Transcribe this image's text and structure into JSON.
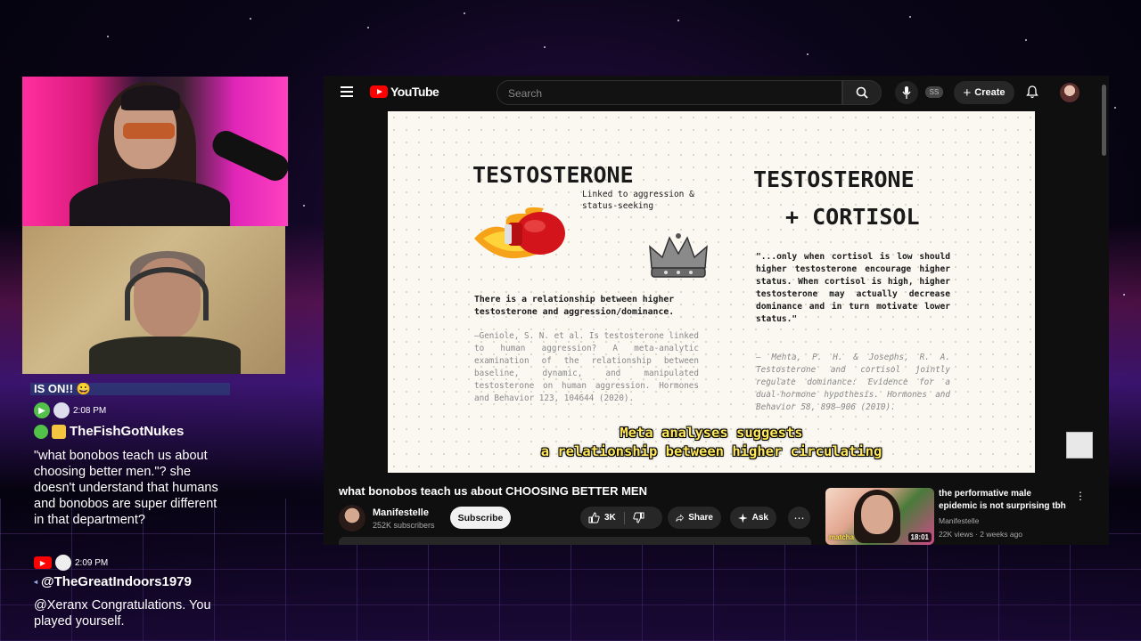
{
  "chat": {
    "top_line": "IS ON!! 😀",
    "msg1": {
      "time": "2:08 PM",
      "user": "TheFishGotNukes",
      "text": "\"what bonobos teach us about choosing better men.\"? she doesn't understand that humans and bonobos are super different in that department?"
    },
    "msg2": {
      "time": "2:09 PM",
      "user": "@TheGreatIndoors1979",
      "text": "@Xeranx Congratulations. You played yourself."
    }
  },
  "youtube": {
    "logo_text": "YouTube",
    "search_placeholder": "Search",
    "ss_badge": "SS",
    "create_label": "Create",
    "video": {
      "title": "what bonobos teach us about CHOOSING BETTER MEN",
      "channel": "Manifestelle",
      "subscribers": "252K subscribers",
      "subscribe_label": "Subscribe",
      "likes": "3K",
      "share_label": "Share",
      "ask_label": "Ask"
    },
    "slide": {
      "left_title": "TESTOSTERONE",
      "left_subtitle": "Linked to aggression & status-seeking",
      "left_body": "There is a relationship between higher testosterone and aggression/dominance.",
      "left_citation": "–Geniole, S. N. et al. Is testosterone linked to human aggression? A meta-analytic examination of the relationship between baseline, dynamic, and manipulated testosterone on human aggression. Hormones and Behavior 123, 104644 (2020).",
      "right_title_1": "TESTOSTERONE",
      "right_title_2": "+ CORTISOL",
      "right_quote": "\"...only when cortisol is low should higher testosterone encourage higher status. When cortisol is high, higher testosterone may actually decrease dominance and in turn motivate lower status.\"",
      "right_citation": "– Mehta, P. H. & Josephs, R. A. Testosterone and cortisol jointly regulate dominance: Evidence for a dual-hormone hypothesis. Hormones and Behavior 58, 898–906 (2010).",
      "caption_1": "Meta analyses suggests",
      "caption_2": "a relationship between higher circulating"
    },
    "recommendation": {
      "title": "the performative male epidemic is not surprising tbh",
      "channel": "Manifestelle",
      "meta": "22K views · 2 weeks ago",
      "duration": "18:01",
      "thumb_overlay": "matcha"
    }
  }
}
